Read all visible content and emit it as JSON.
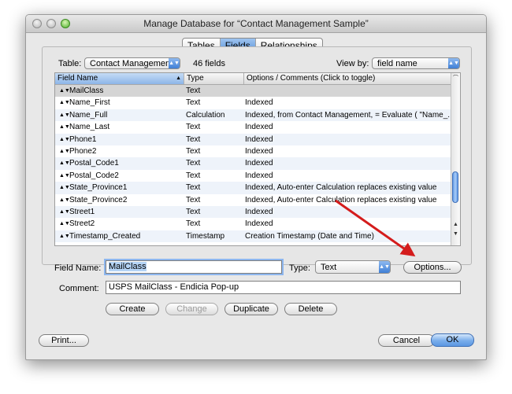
{
  "window": {
    "title": "Manage Database for “Contact Management Sample”"
  },
  "tabs": [
    {
      "label": "Tables",
      "active": false
    },
    {
      "label": "Fields",
      "active": true
    },
    {
      "label": "Relationships",
      "active": false
    }
  ],
  "table_select": {
    "label": "Table:",
    "value": "Contact Management",
    "count": "46 fields"
  },
  "view_by": {
    "label": "View by:",
    "value": "field name"
  },
  "columns": {
    "name": "Field Name",
    "type": "Type",
    "options": "Options / Comments   (Click to toggle)"
  },
  "rows": [
    {
      "name": "MailClass",
      "type": "Text",
      "options": ""
    },
    {
      "name": "Name_First",
      "type": "Text",
      "options": "Indexed"
    },
    {
      "name": "Name_Full",
      "type": "Calculation",
      "options": "Indexed, from Contact Management, = Evaluate ( \"Name_..."
    },
    {
      "name": "Name_Last",
      "type": "Text",
      "options": "Indexed"
    },
    {
      "name": "Phone1",
      "type": "Text",
      "options": "Indexed"
    },
    {
      "name": "Phone2",
      "type": "Text",
      "options": "Indexed"
    },
    {
      "name": "Postal_Code1",
      "type": "Text",
      "options": "Indexed"
    },
    {
      "name": "Postal_Code2",
      "type": "Text",
      "options": "Indexed"
    },
    {
      "name": "State_Province1",
      "type": "Text",
      "options": "Indexed, Auto-enter Calculation replaces existing value"
    },
    {
      "name": "State_Province2",
      "type": "Text",
      "options": "Indexed, Auto-enter Calculation replaces existing value"
    },
    {
      "name": "Street1",
      "type": "Text",
      "options": "Indexed"
    },
    {
      "name": "Street2",
      "type": "Text",
      "options": "Indexed"
    },
    {
      "name": "Timestamp_Created",
      "type": "Timestamp",
      "options": "Creation Timestamp (Date and Time)"
    }
  ],
  "field_name": {
    "label": "Field Name:",
    "value": "MailClass"
  },
  "type_select": {
    "label": "Type:",
    "value": "Text"
  },
  "options_button": "Options...",
  "comment": {
    "label": "Comment:",
    "value": "USPS MailClass - Endicia Pop-up"
  },
  "actions": {
    "create": "Create",
    "change": "Change",
    "duplicate": "Duplicate",
    "delete": "Delete"
  },
  "footer": {
    "print": "Print...",
    "cancel": "Cancel",
    "ok": "OK"
  },
  "colors": {
    "accent": "#5b97e2",
    "arrow": "#d41c1c"
  }
}
